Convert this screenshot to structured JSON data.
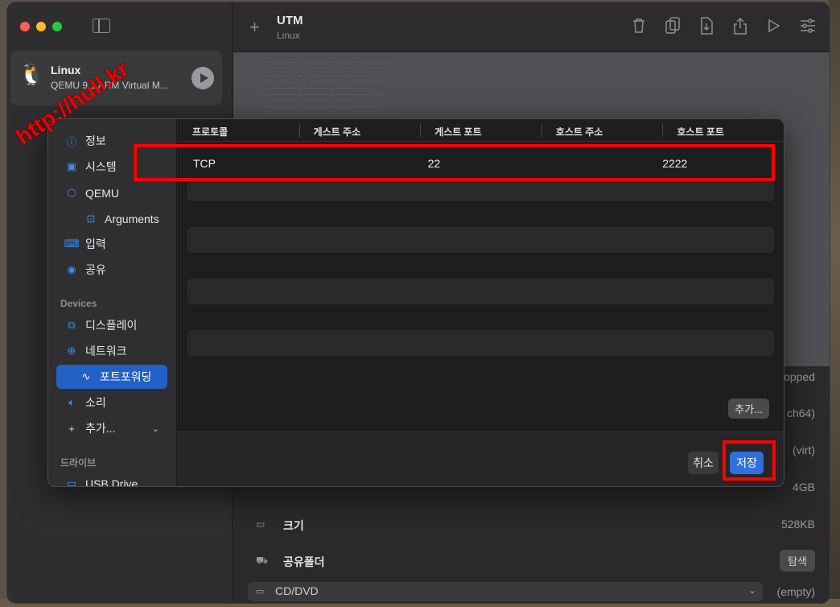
{
  "app": {
    "title": "UTM",
    "subtitle": "Linux"
  },
  "watermark": "http://hull.kr",
  "vm": {
    "name": "Linux",
    "description": "QEMU 9.1 ARM Virtual M..."
  },
  "toolbar": {
    "icons": [
      "trash-icon",
      "clone-icon",
      "download-icon",
      "share-icon",
      "play-icon",
      "settings-icon"
    ]
  },
  "details": {
    "rows": [
      {
        "label": "",
        "value": "opped"
      },
      {
        "label": "",
        "value": "ch64)"
      },
      {
        "label": "",
        "value": "(virt)"
      },
      {
        "label": "",
        "value": "4GB"
      },
      {
        "label": "크기",
        "value": "528KB"
      },
      {
        "label": "공유폴더",
        "value": "탐색"
      }
    ],
    "cd": {
      "label": "CD/DVD",
      "value": "(empty)"
    }
  },
  "dialog": {
    "nav": {
      "info": "정보",
      "system": "시스템",
      "qemu": "QEMU",
      "arguments": "Arguments",
      "input": "입력",
      "sharing": "공유",
      "devices_header": "Devices",
      "display": "디스플레이",
      "network": "네트워크",
      "port_forwarding": "포트포워딩",
      "sound": "소리",
      "add": "추가...",
      "drives_header": "드라이브",
      "usb_drive": "USB Drive"
    },
    "table": {
      "headers": [
        "프로토콜",
        "게스트 주소",
        "게스트 포트",
        "호스트 주소",
        "호스트 포트"
      ],
      "rows": [
        {
          "protocol": "TCP",
          "guest_address": "",
          "guest_port": "22",
          "host_address": "",
          "host_port": "2222"
        }
      ]
    },
    "add_button": "추가...",
    "cancel_button": "취소",
    "save_button": "저장"
  }
}
